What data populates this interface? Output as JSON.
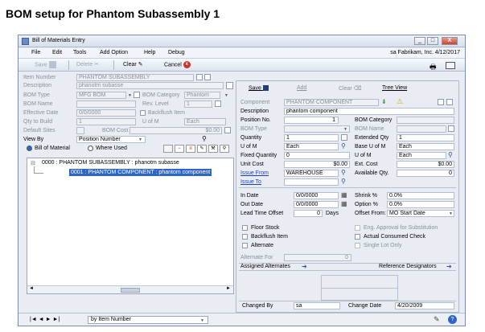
{
  "doc_title": "BOM setup for Phantom Subassembly 1",
  "window": {
    "title": "Bill of Materials Entry",
    "min": "_",
    "max": "□",
    "close": "X"
  },
  "menu": {
    "items": [
      "File",
      "Edit",
      "Tools",
      "Add Option",
      "Help",
      "Debug"
    ],
    "right": "sa  Fabrikam, Inc. 4/12/2017"
  },
  "toolbar": {
    "save": "Save",
    "delete": "Delete",
    "clear": "Clear",
    "cancel": "Cancel"
  },
  "left": {
    "item_number_label": "Item Number",
    "item_number": "PHANTOM SUBASSEMBLY",
    "description_label": "Description",
    "description": "phanotm subasse",
    "bom_type_label": "BOM Type",
    "bom_type": "MFG BOM",
    "bom_category_label": "BOM Category",
    "bom_category": "Phantom",
    "bom_name_label": "BOM Name",
    "rev_level_label": "Rev. Level",
    "rev_level": "1",
    "effective_date_label": "Effective Date",
    "effective_date": "0/0/0000",
    "backflush_label": "Backflush Item",
    "qty_to_build_label": "Qty to Build",
    "qty_to_build": "1",
    "uom_label": "U of M",
    "uom": "Each",
    "default_sites_label": "Default Sites",
    "bom_cost_label": "BOM Cost",
    "bom_cost": "$0.00",
    "view_by_label": "View By",
    "view_by": "Position Number",
    "radio_bom": "Bill of Material",
    "radio_where": "Where Used",
    "tree_root": "0000 : PHANTOM SUBASSEMBLY  :  phanotm subasse",
    "tree_child": "0001 : PHANTOM COMPONENT  :  phantom component"
  },
  "right": {
    "save": "Save",
    "add": "Add",
    "clear": "Clear",
    "tree_view": "Tree View",
    "component_label": "Component",
    "component": "PHANTOM COMPONENT",
    "description_label": "Description",
    "description": "phantom component",
    "position_label": "Position No.",
    "position": "1",
    "bom_category_label": "BOM Category",
    "bom_type_label": "BOM Type",
    "bom_name_label": "BOM Name",
    "quantity_label": "Quantity",
    "quantity": "1",
    "extended_qty_label": "Extended Qty",
    "extended_qty": "1",
    "uom_label": "U of M",
    "uom": "Each",
    "base_uom_label": "Base U of M",
    "base_uom": "Each",
    "fixed_qty_label": "Fixed Quantity",
    "fixed_qty": "0",
    "uom2_label": "U of M",
    "uom2": "Each",
    "unit_cost_label": "Unit Cost",
    "unit_cost": "$0.00",
    "ext_cost_label": "Ext. Cost",
    "ext_cost": "$0.00",
    "issue_from_label": "Issue From",
    "issue_from": "WAREHOUSE",
    "available_label": "Available Qty.",
    "available": "0",
    "issue_to_label": "Issue To",
    "in_date_label": "In Date",
    "in_date": "0/0/0000",
    "shrink_label": "Shrink %",
    "shrink": "0.0%",
    "out_date_label": "Out Date",
    "out_date": "0/0/0000",
    "option_label": "Option %",
    "option": "0.0%",
    "lead_label": "Lead Time Offset",
    "lead": "0",
    "days": "Days",
    "offset_label": "Offset From:",
    "offset": "MO Start Date",
    "floor_stock": "Floor Stock",
    "backflush": "Backflush Item",
    "alternate": "Alternate",
    "eng_approval": "Eng. Approval for Substitution",
    "actual_consumed": "Actual Consumed Check",
    "single_lot": "Single Lot Only",
    "alternate_for_label": "Alternate For",
    "alternate_for": "0",
    "assigned_alternates": "Assigned Alternates",
    "reference_designators": "Reference Designators",
    "changed_by_label": "Changed By",
    "changed_by": "sa",
    "change_date_label": "Change Date",
    "change_date": "4/20/2009"
  },
  "status": {
    "sort": "by Item Number",
    "nav": "|◄  ◄  ►  ►|"
  }
}
